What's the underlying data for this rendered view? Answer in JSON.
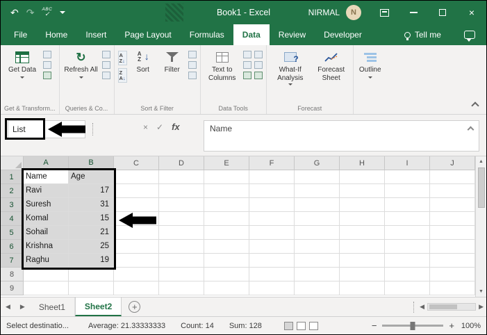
{
  "window": {
    "title": "Book1  -  Excel",
    "user": "NIRMAL",
    "avatar_initial": "N"
  },
  "icons": {
    "undo": "↶",
    "redo": "↷",
    "spell_abc": "ABC",
    "check": "✓",
    "close": "×",
    "refresh": "↻",
    "cancel": "×",
    "fx": "fx",
    "scroll_up": "▲",
    "scroll_down": "▼",
    "scroll_left": "◀",
    "scroll_right": "▶",
    "zoom_out": "−",
    "zoom_in": "+",
    "add_sheet": "+"
  },
  "ribbon": {
    "tabs": [
      {
        "label": "File"
      },
      {
        "label": "Home"
      },
      {
        "label": "Insert"
      },
      {
        "label": "Page Layout"
      },
      {
        "label": "Formulas"
      },
      {
        "label": "Data",
        "active": true
      },
      {
        "label": "Review"
      },
      {
        "label": "Developer"
      }
    ],
    "tell_me": "Tell me",
    "buttons": {
      "get_data": "Get Data",
      "refresh_all": "Refresh All",
      "sort": "Sort",
      "filter": "Filter",
      "text_to_columns": "Text to Columns",
      "what_if": "What-If Analysis",
      "forecast_sheet": "Forecast Sheet",
      "outline": "Outline"
    },
    "group_labels": {
      "get_transform": "Get & Transform...",
      "queries": "Queries & Co...",
      "sort_filter": "Sort & Filter",
      "data_tools": "Data Tools",
      "forecast": "Forecast",
      "outline": ""
    }
  },
  "formula_bar": {
    "name_box": "List",
    "content": "Name"
  },
  "grid": {
    "columns": [
      "A",
      "B",
      "C",
      "D",
      "E",
      "F",
      "G",
      "H",
      "I",
      "J"
    ],
    "selection": {
      "cols": [
        0,
        1
      ],
      "row_start": 0,
      "row_end": 6
    },
    "rows": [
      {
        "n": "1",
        "cells": [
          "Name",
          "Age"
        ]
      },
      {
        "n": "2",
        "cells": [
          "Ravi",
          "17"
        ]
      },
      {
        "n": "3",
        "cells": [
          "Suresh",
          "31"
        ]
      },
      {
        "n": "4",
        "cells": [
          "Komal",
          "15"
        ]
      },
      {
        "n": "5",
        "cells": [
          "Sohail",
          "21"
        ]
      },
      {
        "n": "6",
        "cells": [
          "Krishna",
          "25"
        ]
      },
      {
        "n": "7",
        "cells": [
          "Raghu",
          "19"
        ]
      },
      {
        "n": "8",
        "cells": []
      },
      {
        "n": "9",
        "cells": []
      }
    ]
  },
  "sheets": {
    "tabs": [
      {
        "label": "Sheet1"
      },
      {
        "label": "Sheet2",
        "active": true
      }
    ]
  },
  "status_bar": {
    "message": "Select destinatio...",
    "average": "Average: 21.33333333",
    "count": "Count: 14",
    "sum": "Sum: 128",
    "zoom": "100%"
  },
  "colors": {
    "excel_green": "#217346",
    "selection_fill": "#d9d9d9",
    "annotation": "#000000"
  }
}
